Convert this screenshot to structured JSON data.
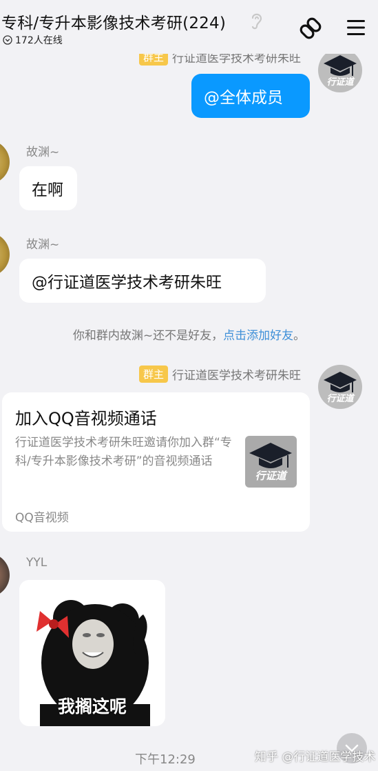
{
  "header": {
    "title": "专科/专升本影像技术考研(224)",
    "online_count": "172人在线"
  },
  "messages": {
    "top_sender_name": "行证道医学技术考研朱旺",
    "top_sender_role": "群主",
    "top_bubble": "@全体成员",
    "reply1_name": "故渊~",
    "reply1_text": "在啊",
    "reply2_name": "故渊~",
    "reply2_text": "@行证道医学技术考研朱旺",
    "notice_prefix": "你和群内故渊~还不是好友，",
    "notice_link": "点击添加好友",
    "notice_suffix": "。",
    "card_sender_role": "群主",
    "card_sender_name": "行证道医学技术考研朱旺",
    "card_title": "加入QQ音视频通话",
    "card_desc": "行证道医学技术考研朱旺邀请你加入群“专科/专升本影像技术考研”的音视频通话",
    "card_source": "QQ音视频",
    "yyl_name": "YYL",
    "sticker_caption": "我搁这呢",
    "timestamp": "下午12:29"
  },
  "avatar_text": "行证道",
  "watermark": "知乎 @行证道医学技术",
  "colors": {
    "self_bubble": "#0a99ff",
    "role_tag": "#f7c74a",
    "link": "#3e8fd8"
  }
}
